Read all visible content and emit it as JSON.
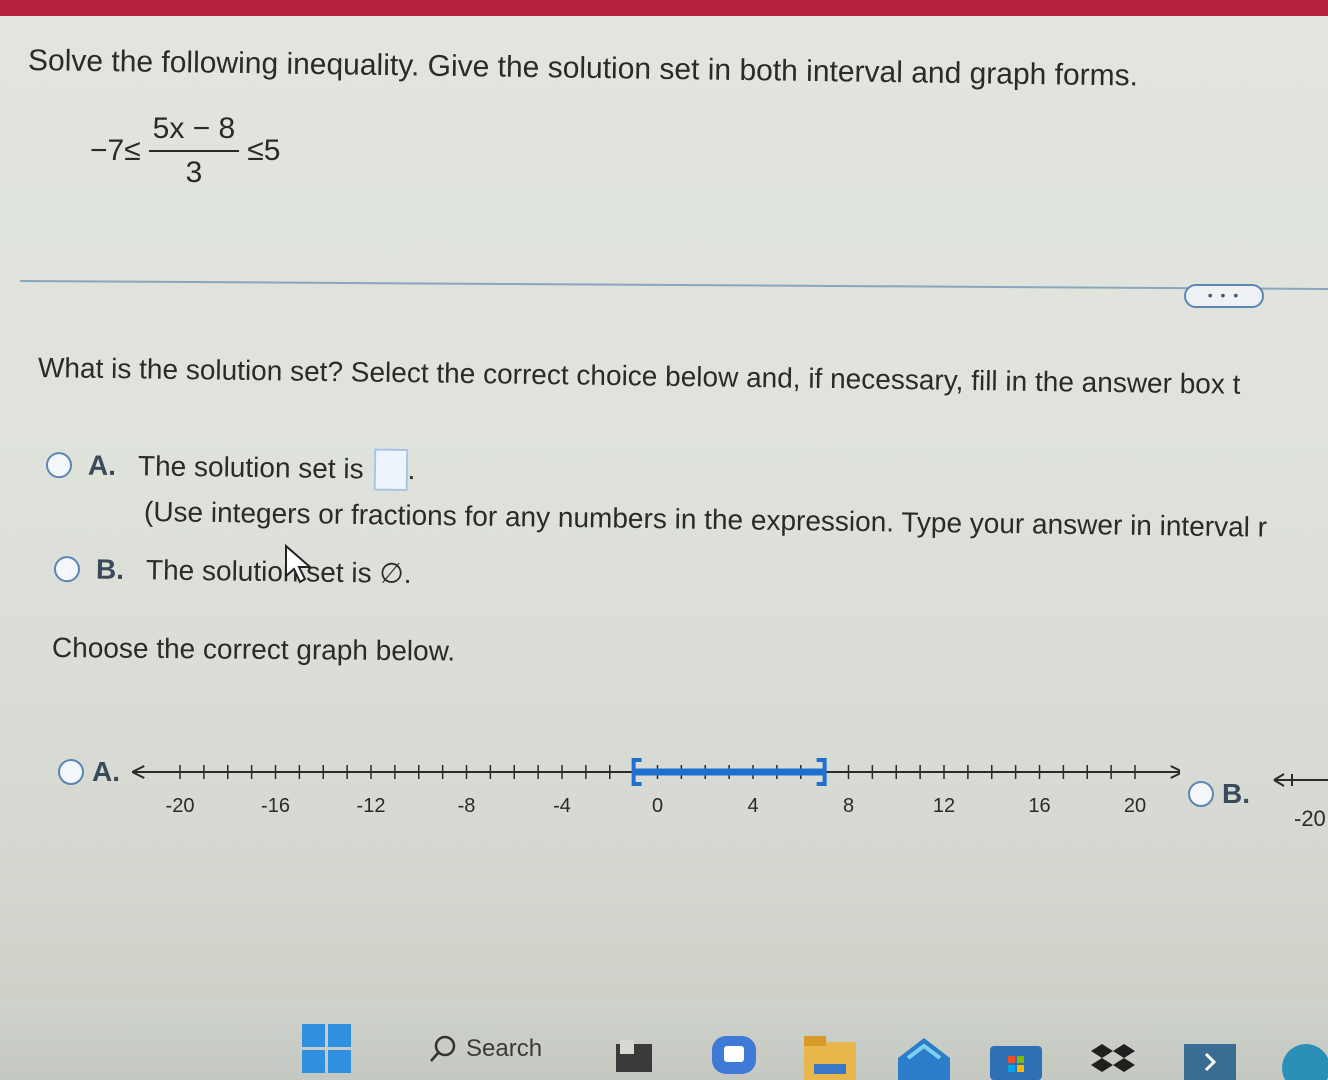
{
  "question": {
    "text": "Solve the following inequality. Give the solution set in both interval and graph forms.",
    "left": "−7≤",
    "numerator": "5x − 8",
    "denominator": "3",
    "right": "≤5"
  },
  "more_button": "• • •",
  "prompt": "What is the solution set? Select the correct choice below and, if necessary, fill in the answer box t",
  "choices": {
    "a": {
      "letter": "A.",
      "text": "The solution set is",
      "period": ".",
      "hint": "(Use integers or fractions for any numbers in the expression. Type your answer in interval r"
    },
    "b": {
      "letter": "B.",
      "text": "The solution set is ∅."
    }
  },
  "graph_prompt": "Choose the correct graph below.",
  "graphs": {
    "a": {
      "letter": "A.",
      "tick_labels": [
        "-20",
        "-16",
        "-12",
        "-8",
        "-4",
        "0",
        "4",
        "8",
        "12",
        "16",
        "20"
      ],
      "shaded_from": -1,
      "shaded_to": 7,
      "range": [
        -22,
        22
      ]
    },
    "b": {
      "letter": "B.",
      "first_label": "-20"
    }
  },
  "taskbar": {
    "search_label": "Search"
  },
  "colors": {
    "accent": "#1f6fd0",
    "radio": "#5b86b4",
    "topbar": "#b5233d"
  }
}
